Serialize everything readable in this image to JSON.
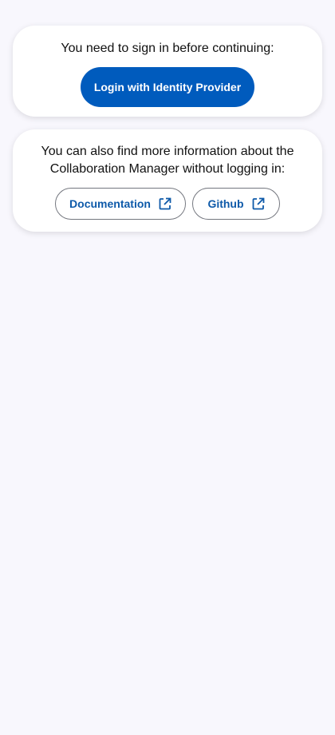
{
  "signin_card": {
    "text": "You need to sign in before continuing:",
    "login_button_label": "Login with Identity Provider"
  },
  "info_card": {
    "text_line1": "You can also find more information about the",
    "text_line2": "Collaboration Manager without logging in:",
    "links": [
      {
        "label": "Documentation",
        "icon": "external-link-icon"
      },
      {
        "label": "Github",
        "icon": "external-link-icon"
      }
    ]
  },
  "colors": {
    "background": "#f8f7fd",
    "primary": "#005bbd",
    "link_text": "#0e5aa9",
    "outline": "#74777f"
  }
}
